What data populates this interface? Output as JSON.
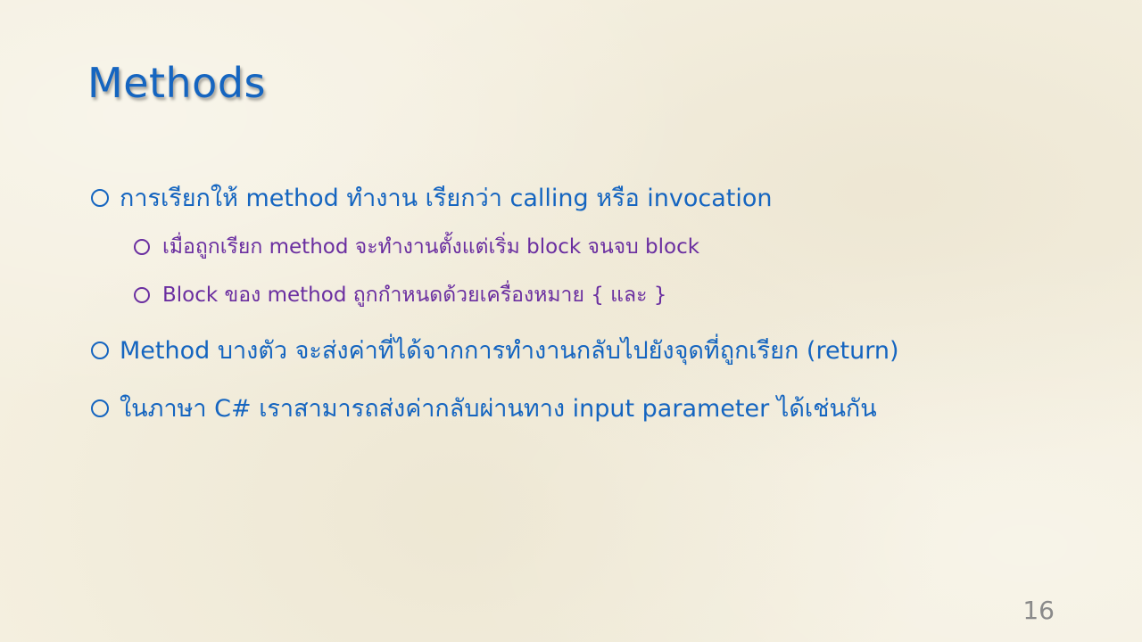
{
  "slide": {
    "title": "Methods",
    "page_number": "16",
    "bullets": [
      {
        "level": 1,
        "text": "การเรียกให้ method ทำงาน เรียกว่า calling หรือ invocation"
      },
      {
        "level": 2,
        "text": "เมื่อถูกเรียก method จะทำงานตั้งแต่เริ่ม block จนจบ block"
      },
      {
        "level": 2,
        "text": "Block ของ method ถูกกำหนดด้วยเครื่องหมาย { และ }"
      },
      {
        "level": 1,
        "text": "Method บางตัว จะส่งค่าที่ได้จากการทำงานกลับไปยังจุดที่ถูกเรียก (return)"
      },
      {
        "level": 1,
        "text": "ในภาษา C# เราสามารถส่งค่ากลับผ่านทาง input parameter ได้เช่นกัน"
      }
    ],
    "colors": {
      "background": "#f4efdf",
      "title": "#1565c0",
      "level1_text": "#1565c0",
      "level2_text": "#6a2ea0",
      "page_number": "#8a8a8a"
    }
  }
}
